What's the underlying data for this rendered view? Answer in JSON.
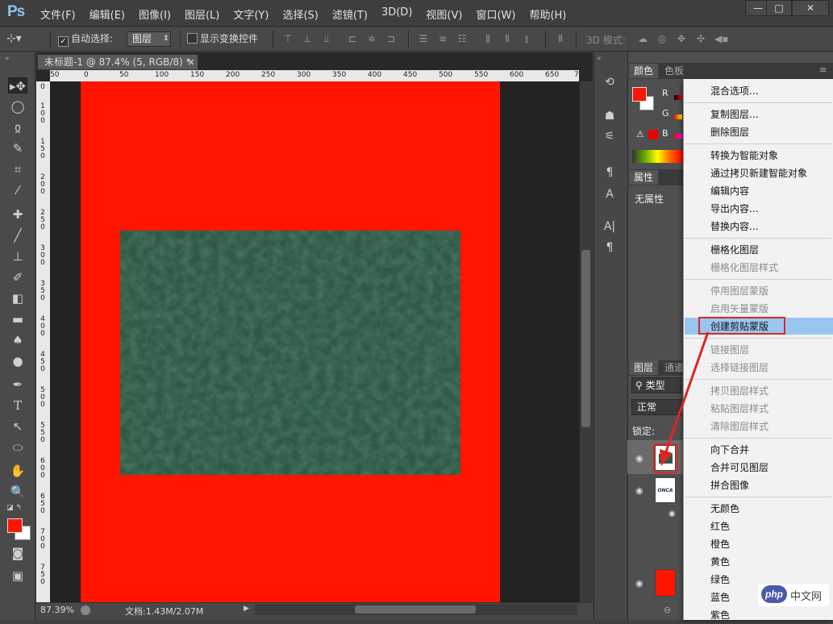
{
  "app": {
    "logo": "Ps"
  },
  "menubar": [
    "文件(F)",
    "编辑(E)",
    "图像(I)",
    "图层(L)",
    "文字(Y)",
    "选择(S)",
    "滤镜(T)",
    "3D(D)",
    "视图(V)",
    "窗口(W)",
    "帮助(H)"
  ],
  "window_controls": [
    "—",
    "□",
    "✕"
  ],
  "options": {
    "auto_select": "自动选择:",
    "layer_select": "图层",
    "show_transform": "显示变换控件",
    "mode3d": "3D 模式:"
  },
  "doc": {
    "tab_title": "未标题-1 @ 87.4% (5, RGB/8) *",
    "close": "×",
    "zoom": "87.39%",
    "doc_size": "文档:1.43M/2.07M"
  },
  "ruler_h": [
    "50",
    "0",
    "50",
    "100",
    "150",
    "200",
    "250",
    "300",
    "350",
    "400",
    "450",
    "500",
    "550",
    "600",
    "650",
    "7"
  ],
  "ruler_v": [
    "0",
    "1\n0\n0",
    "1\n5\n0",
    "2\n0\n0",
    "2\n5\n0",
    "3\n0\n0",
    "3\n5\n0",
    "4\n0\n0",
    "4\n5\n0",
    "5\n0\n0",
    "5\n5\n0",
    "6\n0\n0",
    "6\n5\n0",
    "7\n0\n0",
    "7\n5\n0"
  ],
  "panels": {
    "color_tab": "颜色",
    "swatch_tab": "色板",
    "r": "R",
    "g": "G",
    "b": "B",
    "props_tab": "属性",
    "no_props": "无属性",
    "layers_tab": "图层",
    "channels_tab": "通道",
    "kind": "类型",
    "blend": "正常",
    "lock": "锁定:",
    "thumb_text": "ONCA"
  },
  "context_menu": [
    {
      "label": "混合选项...",
      "disabled": false
    },
    {
      "sep": true
    },
    {
      "label": "复制图层...",
      "disabled": false
    },
    {
      "label": "删除图层",
      "disabled": false
    },
    {
      "sep": true
    },
    {
      "label": "转换为智能对象",
      "disabled": false
    },
    {
      "label": "通过拷贝新建智能对象",
      "disabled": false
    },
    {
      "label": "编辑内容",
      "disabled": false
    },
    {
      "label": "导出内容...",
      "disabled": false
    },
    {
      "label": "替换内容...",
      "disabled": false
    },
    {
      "sep": true
    },
    {
      "label": "栅格化图层",
      "disabled": false
    },
    {
      "label": "栅格化图层样式",
      "disabled": true
    },
    {
      "sep": true
    },
    {
      "label": "停用图层蒙版",
      "disabled": true
    },
    {
      "label": "启用矢量蒙版",
      "disabled": true
    },
    {
      "label": "创建剪贴蒙版",
      "disabled": false,
      "highlight": true
    },
    {
      "sep": true
    },
    {
      "label": "链接图层",
      "disabled": true
    },
    {
      "label": "选择链接图层",
      "disabled": true
    },
    {
      "sep": true
    },
    {
      "label": "拷贝图层样式",
      "disabled": true
    },
    {
      "label": "粘贴图层样式",
      "disabled": true
    },
    {
      "label": "清除图层样式",
      "disabled": true
    },
    {
      "sep": true
    },
    {
      "label": "向下合并",
      "disabled": false
    },
    {
      "label": "合并可见图层",
      "disabled": false
    },
    {
      "label": "拼合图像",
      "disabled": false
    },
    {
      "sep": true
    },
    {
      "label": "无颜色",
      "disabled": false
    },
    {
      "label": "红色",
      "disabled": false
    },
    {
      "label": "橙色",
      "disabled": false
    },
    {
      "label": "黄色",
      "disabled": false
    },
    {
      "label": "绿色",
      "disabled": false
    },
    {
      "label": "蓝色",
      "disabled": false
    },
    {
      "label": "紫色",
      "disabled": false
    }
  ],
  "watermark": {
    "text": "php",
    "sub": "中文网"
  },
  "colors": {
    "canvas": "#ff1500",
    "texture": "#2e5a45",
    "highlight": "#99c6f0",
    "annotation": "#e02424"
  }
}
